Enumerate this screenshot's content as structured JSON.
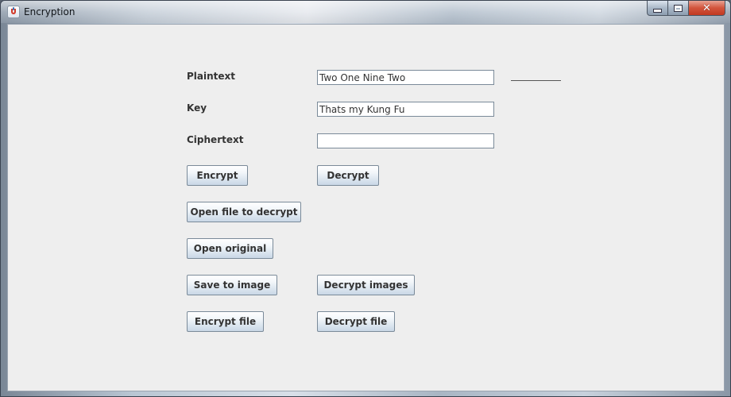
{
  "window": {
    "title": "Encryption",
    "controls": {
      "minimize_icon": "minimize-icon",
      "maximize_icon": "maximize-icon",
      "close_icon": "close-icon",
      "close_glyph": "✕"
    }
  },
  "form": {
    "plaintext_label": "Plaintext",
    "plaintext_value": "Two One Nine Two",
    "key_label": "Key",
    "key_value": "Thats my Kung Fu",
    "ciphertext_label": "Ciphertext",
    "ciphertext_value": ""
  },
  "buttons": {
    "encrypt": "Encrypt",
    "decrypt": "Decrypt",
    "open_file_to_decrypt": "Open file to decrypt",
    "open_original": "Open original",
    "save_to_image": "Save to image",
    "decrypt_images": "Decrypt images",
    "encrypt_file": "Encrypt file",
    "decrypt_file": "Decrypt file"
  },
  "colors": {
    "panel_background": "#eeeeee",
    "label_text": "#333333",
    "close_button": "#c23a22"
  }
}
